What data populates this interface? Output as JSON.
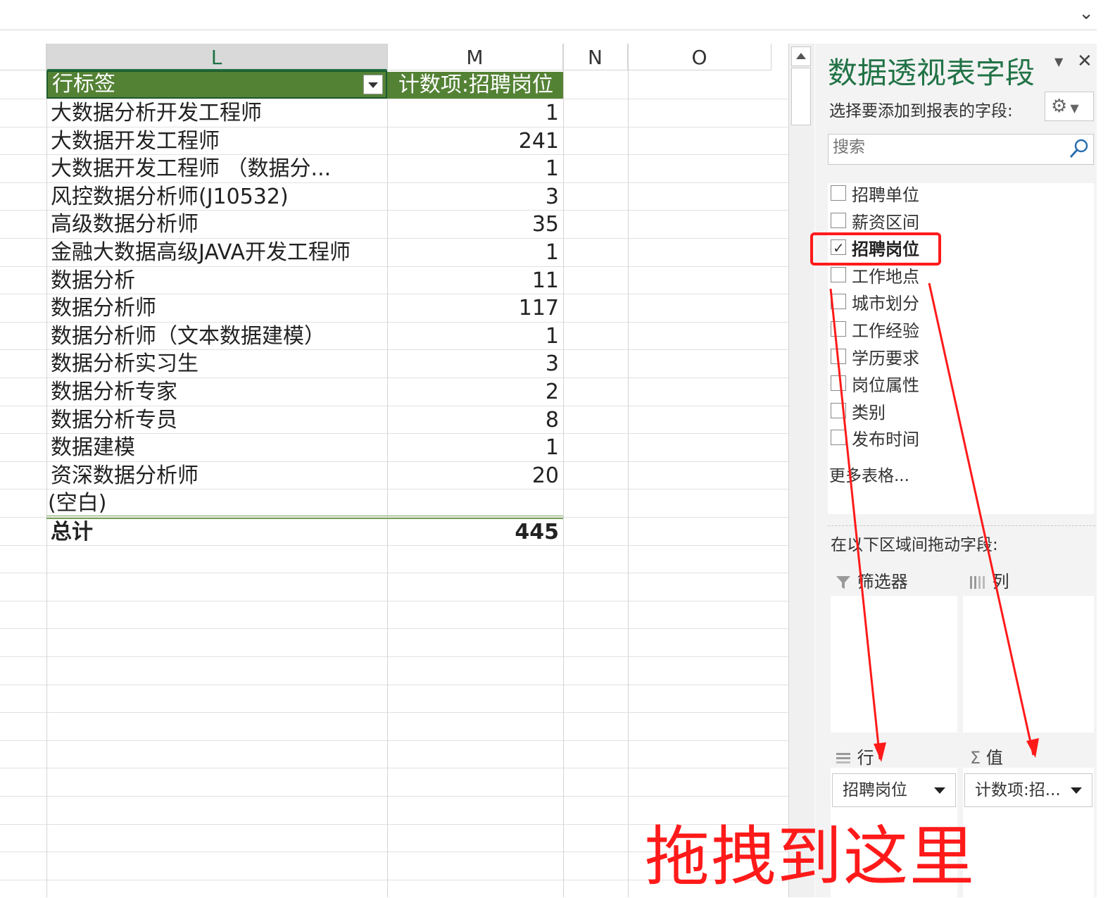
{
  "columns": {
    "l": "L",
    "m": "M",
    "n": "N",
    "o": "O"
  },
  "pivot": {
    "row_header": "行标签",
    "value_header": "计数项:招聘岗位",
    "rows": [
      {
        "label": "大数据分析开发工程师",
        "value": "1"
      },
      {
        "label": "大数据开发工程师",
        "value": "241"
      },
      {
        "label": "大数据开发工程师 （数据分...",
        "value": "1"
      },
      {
        "label": "风控数据分析师(J10532)",
        "value": "3"
      },
      {
        "label": "高级数据分析师",
        "value": "35"
      },
      {
        "label": "金融大数据高级JAVA开发工程师",
        "value": "1"
      },
      {
        "label": "数据分析",
        "value": "11"
      },
      {
        "label": "数据分析师",
        "value": "117"
      },
      {
        "label": "数据分析师（文本数据建模）",
        "value": "1"
      },
      {
        "label": "数据分析实习生",
        "value": "3"
      },
      {
        "label": "数据分析专家",
        "value": "2"
      },
      {
        "label": "数据分析专员",
        "value": "8"
      },
      {
        "label": "数据建模",
        "value": "1"
      },
      {
        "label": "资深数据分析师",
        "value": "20"
      },
      {
        "label": "(空白)",
        "value": ""
      }
    ],
    "total_label": "总计",
    "total_value": "445"
  },
  "pane": {
    "title": "数据透视表字段",
    "subtitle": "选择要添加到报表的字段:",
    "search_placeholder": "搜索",
    "fields": [
      {
        "label": "招聘单位",
        "checked": false
      },
      {
        "label": "薪资区间",
        "checked": false
      },
      {
        "label": "招聘岗位",
        "checked": true
      },
      {
        "label": "工作地点",
        "checked": false
      },
      {
        "label": "城市划分",
        "checked": false
      },
      {
        "label": "工作经验",
        "checked": false
      },
      {
        "label": "学历要求",
        "checked": false
      },
      {
        "label": "岗位属性",
        "checked": false
      },
      {
        "label": "类别",
        "checked": false
      },
      {
        "label": "发布时间",
        "checked": false
      }
    ],
    "more_tables": "更多表格...",
    "drag_hint": "在以下区域间拖动字段:",
    "areas": {
      "filter": "筛选器",
      "columns": "列",
      "rows": "行",
      "values": "值"
    },
    "row_chip": "招聘岗位",
    "value_chip": "计数项:招..."
  },
  "annotation": {
    "text": "拖拽到这里",
    "color": "#ff1a1a"
  },
  "colors": {
    "excel_green": "#217346",
    "pivot_header": "#548235"
  }
}
